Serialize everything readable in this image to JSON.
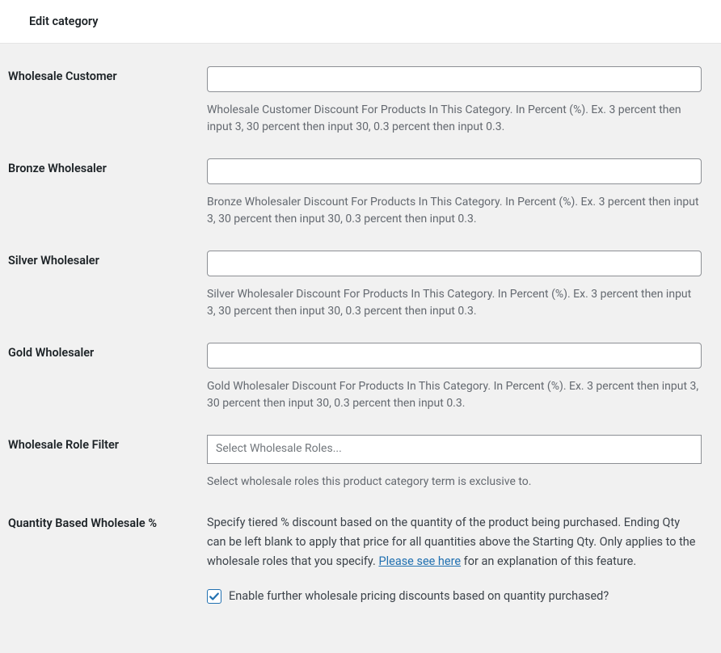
{
  "header": {
    "title": "Edit category"
  },
  "fields": {
    "wholesale_customer": {
      "label": "Wholesale Customer",
      "value": "",
      "help": "Wholesale Customer Discount For Products In This Category. In Percent (%). Ex. 3 percent then input 3, 30 percent then input 30, 0.3 percent then input 0.3."
    },
    "bronze_wholesaler": {
      "label": "Bronze Wholesaler",
      "value": "",
      "help": "Bronze Wholesaler Discount For Products In This Category. In Percent (%). Ex. 3 percent then input 3, 30 percent then input 30, 0.3 percent then input 0.3."
    },
    "silver_wholesaler": {
      "label": "Silver Wholesaler",
      "value": "",
      "help": "Silver Wholesaler Discount For Products In This Category. In Percent (%). Ex. 3 percent then input 3, 30 percent then input 30, 0.3 percent then input 0.3."
    },
    "gold_wholesaler": {
      "label": "Gold Wholesaler",
      "value": "",
      "help": "Gold Wholesaler Discount For Products In This Category. In Percent (%). Ex. 3 percent then input 3, 30 percent then input 30, 0.3 percent then input 0.3."
    },
    "role_filter": {
      "label": "Wholesale Role Filter",
      "placeholder": "Select Wholesale Roles...",
      "help": "Select wholesale roles this product category term is exclusive to."
    },
    "quantity_based": {
      "label": "Quantity Based Wholesale %",
      "desc_before": "Specify tiered % discount based on the quantity of the product being purchased. Ending Qty can be left blank to apply that price for all quantities above the Starting Qty. Only applies to the wholesale roles that you specify. ",
      "link_text": "Please see here",
      "desc_after": " for an explanation of this feature.",
      "checkbox_label": "Enable further wholesale pricing discounts based on quantity purchased?",
      "checked": true
    }
  }
}
